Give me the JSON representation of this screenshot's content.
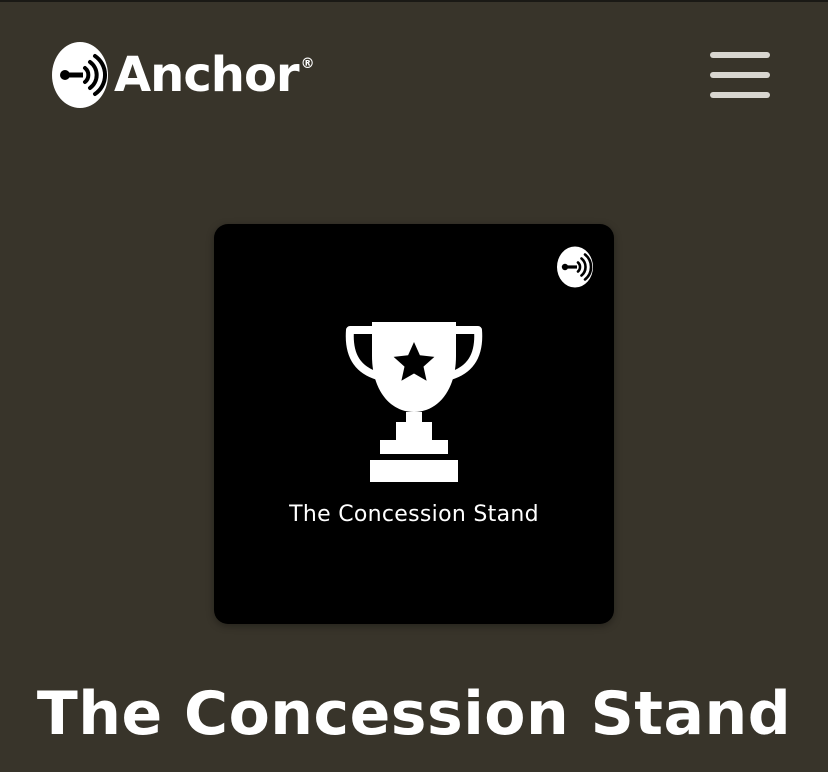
{
  "header": {
    "brand_name": "Anchor",
    "brand_reg": "®",
    "logo_icon": "anchor-logo-icon",
    "menu_icon": "hamburger-menu-icon"
  },
  "podcast": {
    "cover_caption": "The Concession Stand",
    "cover_icon": "trophy-icon",
    "cover_badge_icon": "anchor-badge-icon",
    "title": "The Concession Stand"
  },
  "colors": {
    "background": "#38342a",
    "cover_background": "#000000",
    "text": "#ffffff",
    "menu_bar": "#d8d6d0"
  }
}
